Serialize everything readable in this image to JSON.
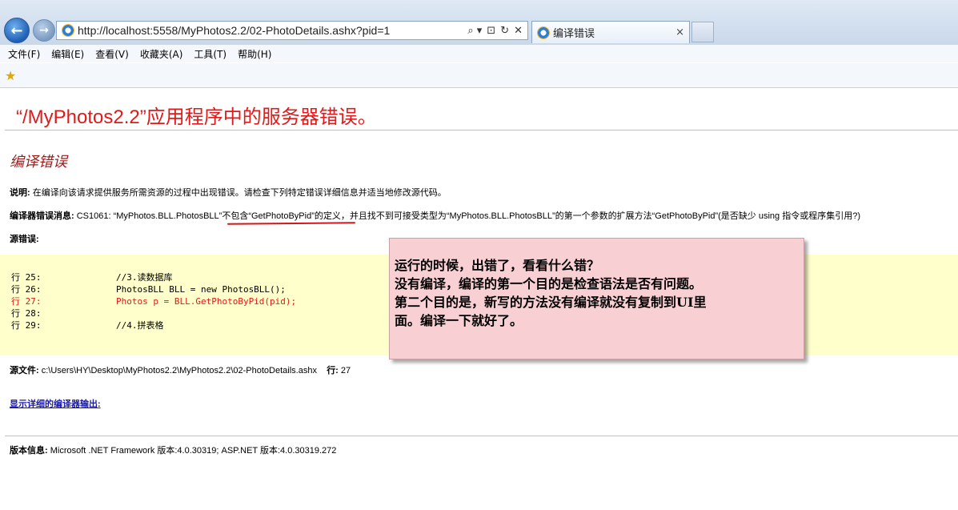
{
  "browser": {
    "url": "http://localhost:5558/MyPhotos2.2/02-PhotoDetails.ashx?pid=1",
    "tab_title": "编译错误",
    "tab_close": "×",
    "back_glyph": "←",
    "forward_glyph": "→",
    "address_tools": [
      "⌕ ▾",
      "⊡",
      "↻",
      "✕"
    ],
    "favorites_icon": "star-icon"
  },
  "menu": {
    "items": [
      "文件(F)",
      "编辑(E)",
      "查看(V)",
      "收藏夹(A)",
      "工具(T)",
      "帮助(H)"
    ]
  },
  "page": {
    "title": "“/MyPhotos2.2”应用程序中的服务器错误。",
    "section_title": "编译错误",
    "description_label": "说明:",
    "description_text": " 在编译向该请求提供服务所需资源的过程中出现错误。请检查下列特定错误详细信息并适当地修改源代码。",
    "compiler_label": "编译器错误消息:",
    "compiler_text": " CS1061: “MyPhotos.BLL.PhotosBLL”不包含“GetPhotoByPid”的定义，并且找不到可接受类型为“MyPhotos.BLL.PhotosBLL”的第一个参数的扩展方法“GetPhotoByPid”(是否缺少 using 指令或程序集引用?)",
    "source_error_label": "源错误:",
    "code_lines": [
      {
        "ln": "行 25:",
        "code": "//3.读数据库"
      },
      {
        "ln": "行 26:",
        "code": "PhotosBLL BLL = new PhotosBLL();"
      },
      {
        "ln": "行 27:",
        "code": "Photos p = BLL.GetPhotoByPid(pid);"
      },
      {
        "ln": "行 28:",
        "code": ""
      },
      {
        "ln": "行 29:",
        "code": "//4.拼表格"
      }
    ],
    "source_file_label": "源文件:",
    "source_file_path": " c:\\Users\\HY\\Desktop\\MyPhotos2.2\\MyPhotos2.2\\02-PhotoDetails.ashx",
    "source_line_label": "行:",
    "source_line_value": " 27",
    "detail_link": "显示详细的编译器输出:",
    "version_label": "版本信息:",
    "version_text": " Microsoft .NET Framework 版本:4.0.30319; ASP.NET 版本:4.0.30319.272"
  },
  "note": {
    "lines": [
      "运行的时候，出错了，看看什么错？",
      "没有编译，编译的第一个目的是检查语法是否有问题。",
      "第二个目的是，新写的方法没有编译就没有复制到UI里",
      "面。编译一下就好了。"
    ]
  },
  "colors": {
    "error_red": "#e01a1a",
    "section_title": "#9b1c1c",
    "code_background": "#ffffcc",
    "note_background": "#f8d0d4",
    "link_blue": "#1a1aa8"
  }
}
